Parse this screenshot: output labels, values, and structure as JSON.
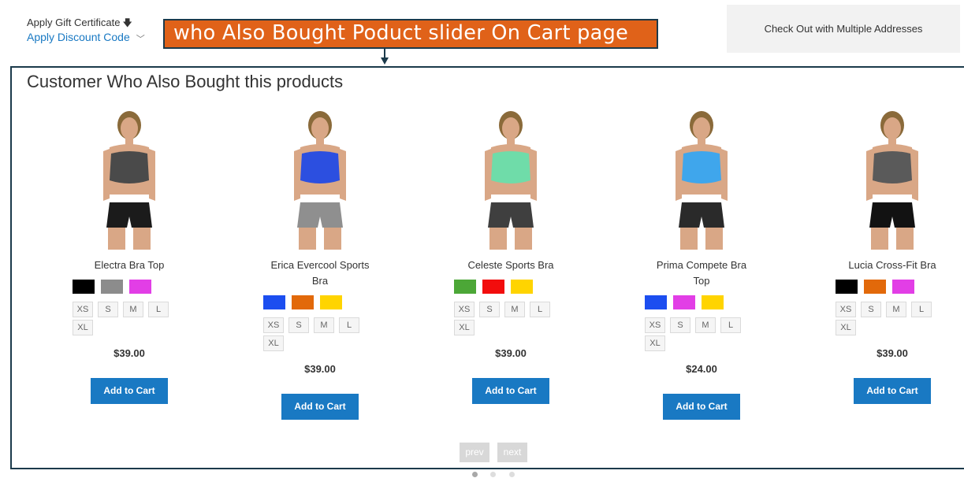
{
  "top": {
    "gift_label": "Apply Gift Certificate",
    "discount_label": "Apply Discount Code",
    "multi_label": "Check Out with Multiple Addresses"
  },
  "annotation": {
    "text": "who Also Bought Poduct slider On Cart page",
    "bg_color": "#e06219",
    "border_color": "#1b3a4b"
  },
  "section": {
    "title": "Customer Who Also Bought this products"
  },
  "products": [
    {
      "name_line1": "Electra Bra Top",
      "name_line2": "",
      "top_color": "#4a4a4a",
      "bottom_color": "#1b1b1b",
      "swatches": [
        "#000000",
        "#8c8c8c",
        "#e23ee6"
      ],
      "sizes": [
        "XS",
        "S",
        "M",
        "L",
        "XL"
      ],
      "price": "$39.00",
      "button": "Add to Cart"
    },
    {
      "name_line1": "Erica Evercool Sports",
      "name_line2": "Bra",
      "top_color": "#2c4fe0",
      "bottom_color": "#8f8f8f",
      "swatches": [
        "#1c4ef0",
        "#e2690a",
        "#ffd400"
      ],
      "sizes": [
        "XS",
        "S",
        "M",
        "L",
        "XL"
      ],
      "price": "$39.00",
      "button": "Add to Cart"
    },
    {
      "name_line1": "Celeste Sports Bra",
      "name_line2": "",
      "top_color": "#6fdca9",
      "bottom_color": "#3f3f3f",
      "swatches": [
        "#4ca737",
        "#f20d0d",
        "#ffd400"
      ],
      "sizes": [
        "XS",
        "S",
        "M",
        "L",
        "XL"
      ],
      "price": "$39.00",
      "button": "Add to Cart"
    },
    {
      "name_line1": "Prima Compete Bra",
      "name_line2": "Top",
      "top_color": "#3fa6ec",
      "bottom_color": "#2a2a2a",
      "swatches": [
        "#1c4ef0",
        "#e23ee6",
        "#ffd400"
      ],
      "sizes": [
        "XS",
        "S",
        "M",
        "L",
        "XL"
      ],
      "price": "$24.00",
      "button": "Add to Cart"
    },
    {
      "name_line1": "Lucia Cross-Fit Bra",
      "name_line2": "",
      "top_color": "#5a5a5a",
      "bottom_color": "#121212",
      "swatches": [
        "#000000",
        "#e2690a",
        "#e23ee6"
      ],
      "sizes": [
        "XS",
        "S",
        "M",
        "L",
        "XL"
      ],
      "price": "$39.00",
      "button": "Add to Cart"
    }
  ],
  "pager": {
    "prev": "prev",
    "next": "next",
    "active_dot": 1,
    "dot_count": 3
  },
  "colors": {
    "accent": "#1979c3",
    "frame": "#1b3a4b"
  }
}
